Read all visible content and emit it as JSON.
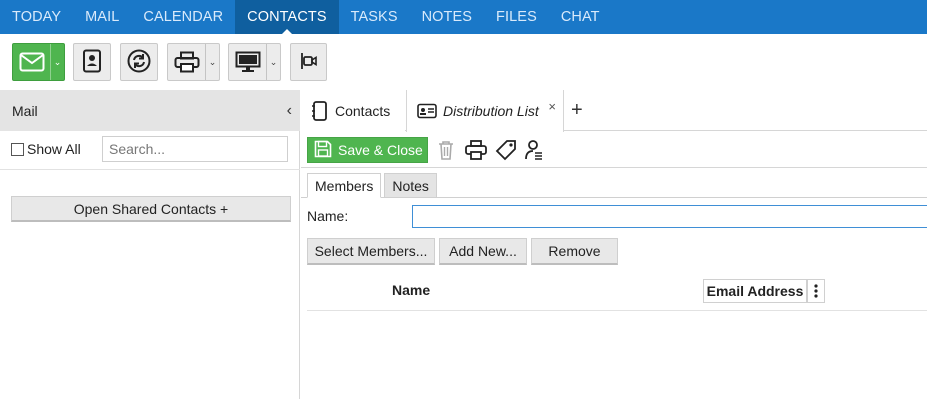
{
  "nav": {
    "items": [
      {
        "label": "TODAY"
      },
      {
        "label": "MAIL"
      },
      {
        "label": "CALENDAR"
      },
      {
        "label": "CONTACTS"
      },
      {
        "label": "TASKS"
      },
      {
        "label": "NOTES"
      },
      {
        "label": "FILES"
      },
      {
        "label": "CHAT"
      }
    ],
    "active": "CONTACTS"
  },
  "toolbar": {
    "buttons": [
      {
        "icon": "mail-icon",
        "has_dropdown": true
      },
      {
        "icon": "address-book-icon",
        "has_dropdown": false
      },
      {
        "icon": "sync-icon",
        "has_dropdown": false
      },
      {
        "icon": "printer-icon",
        "has_dropdown": true
      },
      {
        "icon": "monitor-icon",
        "has_dropdown": true
      },
      {
        "icon": "video-call-icon",
        "has_dropdown": false
      }
    ],
    "dropdown_glyph": "⌄"
  },
  "left": {
    "title": "Mail",
    "collapse_glyph": "‹",
    "show_all_label": "Show All",
    "search_placeholder": "Search...",
    "open_shared_label": "Open Shared Contacts +"
  },
  "tabs": {
    "contacts_label": "Contacts",
    "distribution_label": "Distribution List",
    "close_glyph": "×",
    "add_glyph": "+"
  },
  "actions": {
    "save_close_label": "Save & Close"
  },
  "form": {
    "subtabs": [
      "Members",
      "Notes"
    ],
    "name_label": "Name:",
    "name_value": "",
    "member_buttons": [
      "Select Members...",
      "Add New...",
      "Remove"
    ],
    "columns": {
      "name": "Name",
      "email": "Email Address"
    },
    "column_menu_glyph": "⋮"
  },
  "colors": {
    "nav_bg": "#1a78c8",
    "nav_active": "#0f5f9f",
    "green": "#4fb54f"
  }
}
